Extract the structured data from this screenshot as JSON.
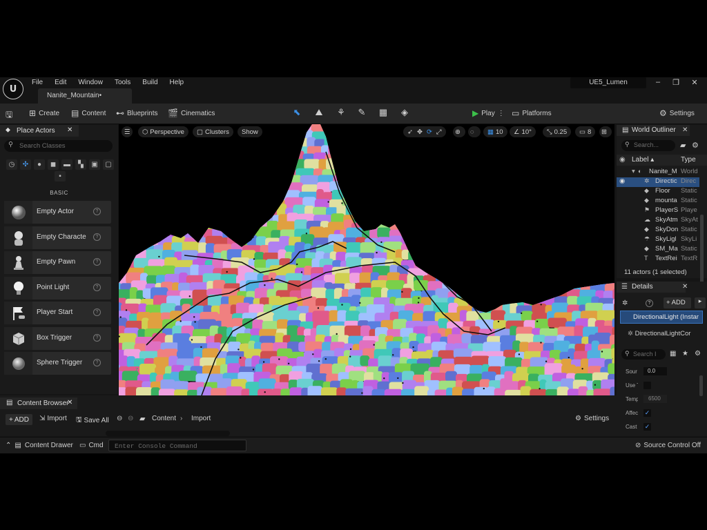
{
  "menu": {
    "items": [
      "File",
      "Edit",
      "Window",
      "Tools",
      "Build",
      "Help"
    ],
    "document_tab": "Nanite_Mountain•",
    "project_name": "UE5_Lumen"
  },
  "toolbar": {
    "create": "Create",
    "content": "Content",
    "blueprints": "Blueprints",
    "cinematics": "Cinematics",
    "play": "Play",
    "platforms": "Platforms",
    "settings": "Settings"
  },
  "place_actors": {
    "tab_title": "Place Actors",
    "search_placeholder": "Search Classes",
    "category": "BASIC",
    "items": [
      {
        "label": "Empty Actor",
        "icon": "sphere-icon"
      },
      {
        "label": "Empty Characte",
        "icon": "character-icon"
      },
      {
        "label": "Empty Pawn",
        "icon": "pawn-icon"
      },
      {
        "label": "Point Light",
        "icon": "bulb-icon"
      },
      {
        "label": "Player Start",
        "icon": "flag-icon"
      },
      {
        "label": "Box Trigger",
        "icon": "box-icon"
      },
      {
        "label": "Sphere Trigger",
        "icon": "sphere-trigger-icon"
      }
    ]
  },
  "viewport": {
    "view_mode": "Perspective",
    "show_mode": "Clusters",
    "show_label": "Show",
    "grid_snap": "10",
    "rotation_snap": "10°",
    "scale_snap": "0.25",
    "camera_speed": "8",
    "accent_color": "#0070e0"
  },
  "outliner": {
    "tab_title": "World Outliner",
    "search_placeholder": "Search...",
    "col_label": "Label",
    "col_type": "Type",
    "rows": [
      {
        "name": "Nanite_M",
        "type": "World"
      },
      {
        "name": "Directic",
        "type": "Direc"
      },
      {
        "name": "Floor",
        "type": "Static"
      },
      {
        "name": "mounta",
        "type": "Static"
      },
      {
        "name": "PlayerS",
        "type": "Playe"
      },
      {
        "name": "SkyAtm",
        "type": "SkyAt"
      },
      {
        "name": "SkyDon",
        "type": "Static"
      },
      {
        "name": "SkyLigl",
        "type": "SkyLi"
      },
      {
        "name": "SM_Ma",
        "type": "Static"
      },
      {
        "name": "TextRei",
        "type": "TextR"
      }
    ],
    "count": "11 actors (1 selected)"
  },
  "details": {
    "tab_title": "Details",
    "add_label": "ADD",
    "selected_instance": "DirectionalLight (Instar",
    "component": "DirectionalLightCor",
    "search_placeholder": "Search I",
    "props": [
      {
        "label": "Sour",
        "value": "0.0"
      },
      {
        "label": "Use T",
        "value": ""
      },
      {
        "label": "Temp",
        "value": "6500"
      },
      {
        "label": "Affec",
        "value": "✓"
      },
      {
        "label": "Cast",
        "value": "✓"
      }
    ]
  },
  "content_browser": {
    "tab_title": "Content Browser",
    "add_label": "ADD",
    "import_label": "Import",
    "save_all_label": "Save All",
    "breadcrumb": [
      "Content",
      "Import"
    ],
    "settings_label": "Settings"
  },
  "status": {
    "content_drawer": "Content Drawer",
    "cmd": "Cmd",
    "console_placeholder": "Enter Console Command",
    "source_control": "Source Control Off"
  }
}
